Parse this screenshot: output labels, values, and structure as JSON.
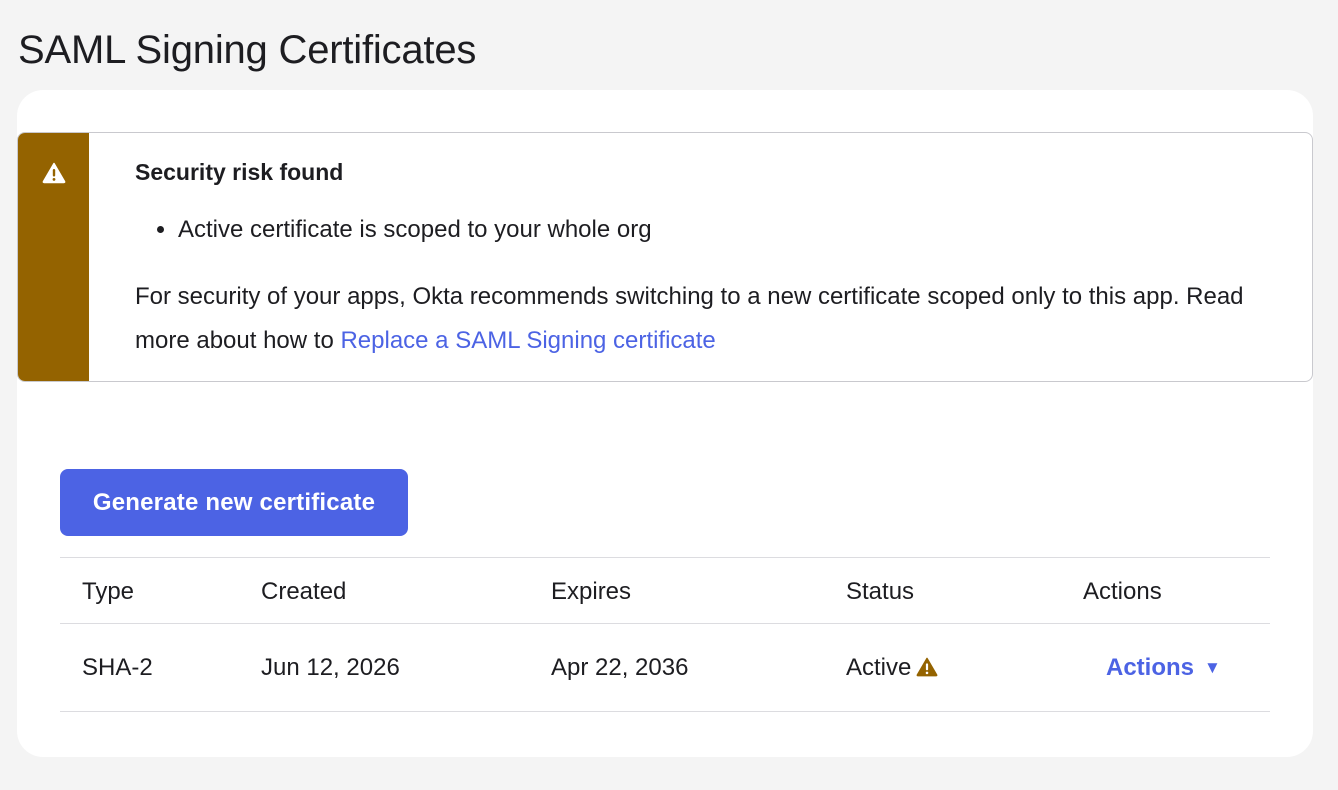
{
  "page": {
    "title": "SAML Signing Certificates"
  },
  "alert": {
    "title": "Security risk found",
    "items": [
      "Active certificate is scoped to your whole org"
    ],
    "body": "For security of your apps, Okta recommends switching to a new certificate scoped only to this app. Read more about how to ",
    "link_text": "Replace a SAML Signing certificate",
    "icon": "warning-triangle-icon"
  },
  "toolbar": {
    "generate_label": "Generate new certificate"
  },
  "table": {
    "headers": {
      "type": "Type",
      "created": "Created",
      "expires": "Expires",
      "status": "Status",
      "actions": "Actions"
    },
    "rows": [
      {
        "type": "SHA-2",
        "created": "Jun 12, 2026",
        "expires": "Apr 22, 2036",
        "status": "Active",
        "actions_label": "Actions",
        "caret": "▼"
      }
    ]
  },
  "colors": {
    "page_bg": "#f4f4f4",
    "accent": "#4c63e4",
    "warning": "#946300",
    "text": "#1d1d21",
    "border": "#dcdce0"
  }
}
